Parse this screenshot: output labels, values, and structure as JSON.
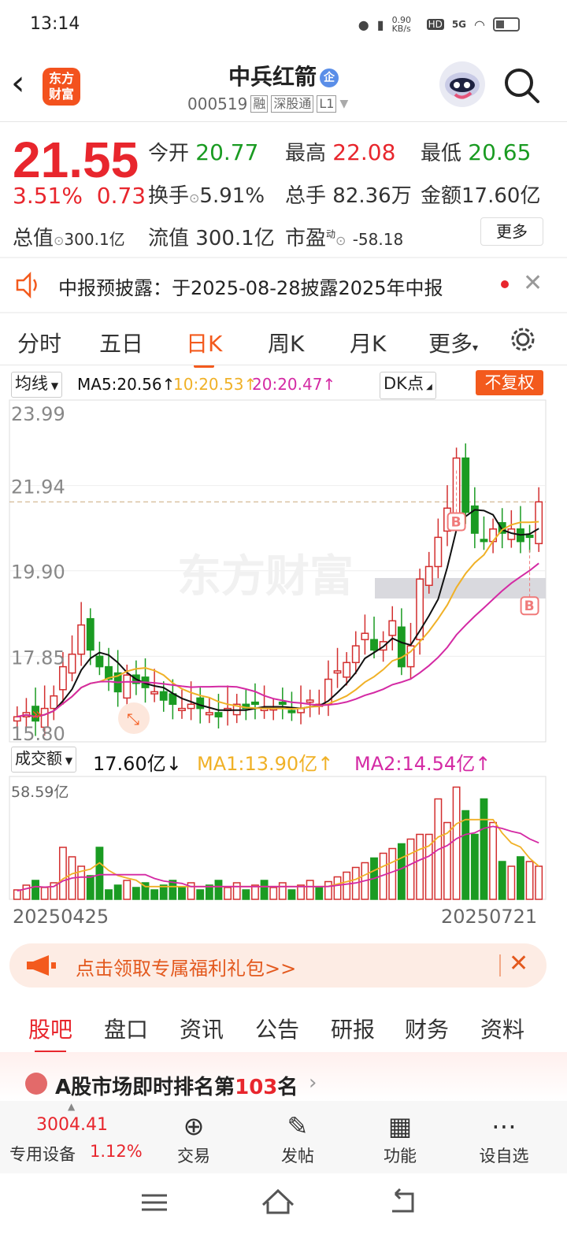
{
  "status_bar": {
    "time": "13:14",
    "net_speed": "0.90 KB/s",
    "hd": "HD",
    "signal": "5G"
  },
  "header": {
    "logo_text_1": "东方",
    "logo_text_2": "财富",
    "stock_name": "中兵红箭",
    "qi_badge": "企",
    "code": "000519",
    "tag_rong": "融",
    "tag_shen": "深股通",
    "tag_level": "L1"
  },
  "quote": {
    "price": "21.55",
    "change_pct": "3.51%",
    "change_amt": "0.73",
    "open_label": "今开",
    "open": "20.77",
    "high_label": "最高",
    "high": "22.08",
    "low_label": "最低",
    "low": "20.65",
    "turnover_label": "换手",
    "turnover": "5.91%",
    "volume_label": "总手",
    "volume": "82.36万",
    "amount_label": "金额",
    "amount": "17.60亿",
    "mktcap_label": "总值",
    "mktcap": "300.1亿",
    "float_label": "流值",
    "float": "300.1亿",
    "pe_label": "市盈",
    "pe_sup": "动",
    "pe": "-58.18",
    "more_button": "更多"
  },
  "notice": {
    "text": "中报预披露：于2025-08-28披露2025年中报"
  },
  "chart_tabs": [
    "分时",
    "五日",
    "日K",
    "周K",
    "月K",
    "更多"
  ],
  "chart_tabs_active": 2,
  "ma_row": {
    "selector": "均线",
    "ma5": "MA5:20.56",
    "ma10": "10:20.53",
    "ma20": "20:20.47",
    "dk_button": "DK点",
    "fuquan": "不复权"
  },
  "chart_data": {
    "type": "candlestick",
    "y_ticks": [
      "23.99",
      "21.94",
      "19.90",
      "17.85",
      "15.80"
    ],
    "ylim": [
      15.8,
      23.99
    ],
    "reference_price": 21.55,
    "watermark": "东方财富",
    "signal_marker": "B",
    "x_start_label": "20250425",
    "x_end_label": "20250721",
    "ma_colors": {
      "ma5": "#111111",
      "ma10": "#f0b127",
      "ma20": "#d42aa4"
    },
    "up_color": "#d32f2f",
    "down_color": "#1a9b22",
    "volume": {
      "selector": "成交额",
      "value": "17.60亿",
      "ma1": "MA1:13.90亿",
      "ma2": "MA2:14.54亿",
      "max_label": "58.59亿"
    }
  },
  "promo": {
    "text": "点击领取专属福利礼包>>"
  },
  "sub_tabs": [
    "股吧",
    "盘口",
    "资讯",
    "公告",
    "研报",
    "财务",
    "资料"
  ],
  "sub_tabs_active": 0,
  "rank": {
    "prefix": "A股市场即时排名第",
    "number": "103",
    "suffix": "名"
  },
  "bottom_nav": {
    "index_value": "3004.41",
    "index_name": "专用设备",
    "index_pct": "1.12%",
    "items": [
      {
        "label": "交易",
        "icon": "yen-icon"
      },
      {
        "label": "发帖",
        "icon": "edit-icon"
      },
      {
        "label": "功能",
        "icon": "grid-icon"
      },
      {
        "label": "设自选",
        "icon": "more-icon"
      }
    ]
  }
}
